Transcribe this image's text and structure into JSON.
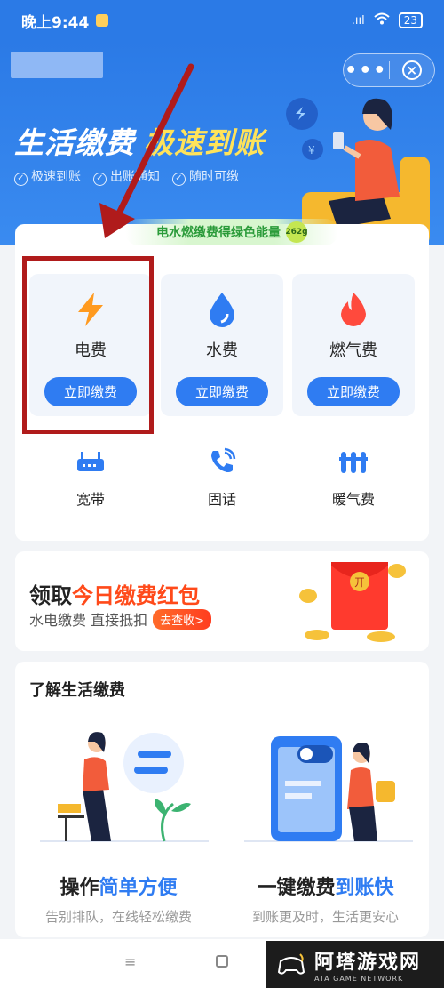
{
  "status_bar": {
    "time": "晚上9:44",
    "signal": ".ııl",
    "wifi": "wifi",
    "battery": "23"
  },
  "header": {
    "more_label": "•••",
    "close_label": "×"
  },
  "hero": {
    "slogan_main": "生活缴费",
    "slogan_highlight": "极速到账",
    "features": [
      "极速到账",
      "出账通知",
      "随时可缴"
    ],
    "energy_text": "电水燃缴费得绿色能量",
    "energy_badge": "262g"
  },
  "bills": [
    {
      "name": "电费",
      "action": "立即缴费",
      "icon": "lightning-icon",
      "color": "#ff9a1f"
    },
    {
      "name": "水费",
      "action": "立即缴费",
      "icon": "water-drop-icon",
      "color": "#2f7cf2"
    },
    {
      "name": "燃气费",
      "action": "立即缴费",
      "icon": "flame-icon",
      "color": "#ff4a3d"
    }
  ],
  "others": [
    {
      "name": "宽带",
      "icon": "router-icon"
    },
    {
      "name": "固话",
      "icon": "phone-icon"
    },
    {
      "name": "暖气费",
      "icon": "heater-icon"
    }
  ],
  "promo": {
    "title_prefix": "领取",
    "title_highlight": "今日缴费红包",
    "subtitle": "水电缴费 直接抵扣",
    "button": "去查收>",
    "packet_char": "开"
  },
  "learn": {
    "heading": "了解生活缴费",
    "items": [
      {
        "title_a": "操作",
        "title_b": "简单方便",
        "desc": "告别排队，在线轻松缴费"
      },
      {
        "title_a": "一键缴费",
        "title_b": "到账快",
        "desc": "到账更及时，生活更安心"
      }
    ]
  },
  "navbar": {
    "menu": "≡"
  },
  "watermark": {
    "title": "阿塔游戏网",
    "subtitle": "ATA GAME NETWORK"
  }
}
